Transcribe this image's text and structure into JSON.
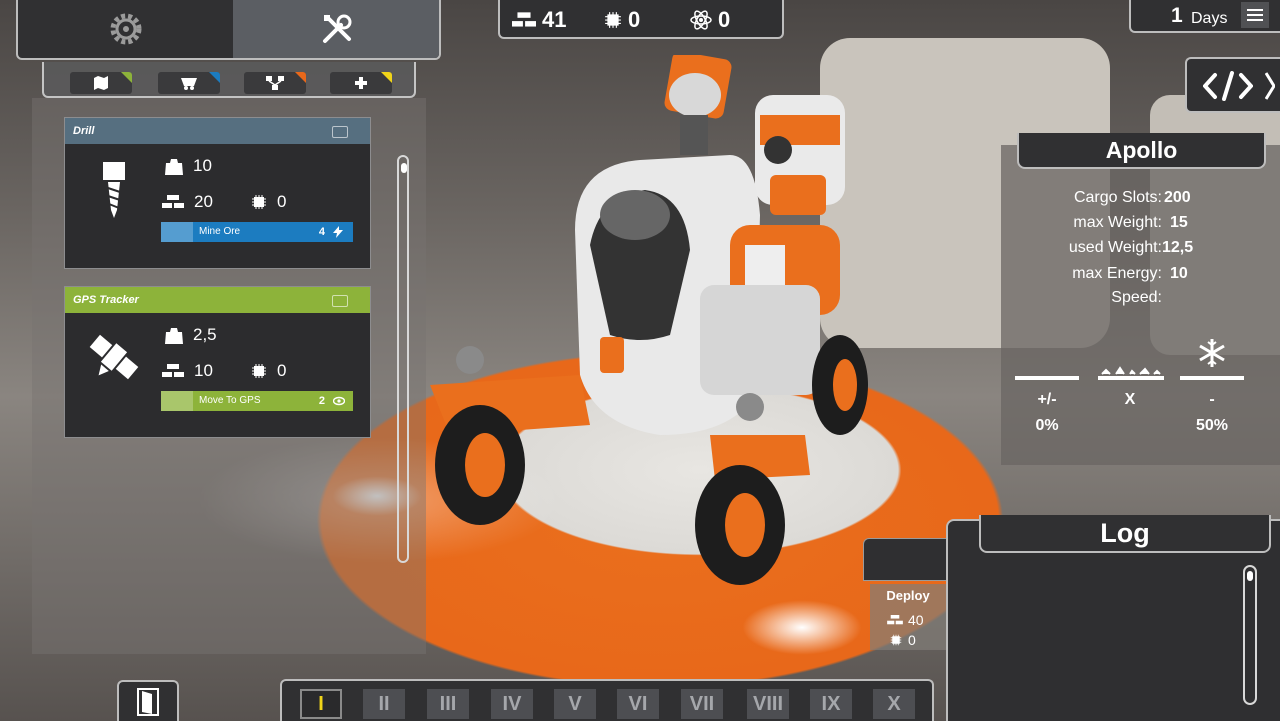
{
  "colors": {
    "panel": "#303032",
    "blue_accent": "#1c7cc0",
    "green_accent": "#8db33a",
    "yellow_active": "#f0d419",
    "orange_scene": "#e8681a"
  },
  "tabs": [
    {
      "icon": "gear-icon"
    },
    {
      "icon": "wrench-screwdriver-icon"
    }
  ],
  "subtabs": [
    {
      "icon": "map-icon",
      "accent": "#8db33a"
    },
    {
      "icon": "mine-cart-icon",
      "accent": "#1c7cc0"
    },
    {
      "icon": "network-icon",
      "accent": "#e8681a"
    },
    {
      "icon": "plus-icon",
      "accent": "#f0d419"
    }
  ],
  "modules": [
    {
      "name": "Drill",
      "icon": "drill-icon",
      "weight": "10",
      "bars": "20",
      "chips": "0",
      "action_label": "Mine Ore",
      "action_cost": "4",
      "action_icon": "mine-cart-icon",
      "cost_icon": "lightning-icon",
      "header_color": "#566f80",
      "action_color": "#1c7cc0"
    },
    {
      "name": "GPS Tracker",
      "icon": "satellite-icon",
      "weight": "2,5",
      "bars": "10",
      "chips": "0",
      "action_label": "Move To GPS",
      "action_cost": "2",
      "action_icon": "map-icon",
      "cost_icon": "eye-icon",
      "header_color": "#8db33a",
      "action_color": "#8db33a"
    }
  ],
  "resources": {
    "bars": "41",
    "chips": "0",
    "atoms": "0"
  },
  "days": {
    "count": "1",
    "label": "Days"
  },
  "robot": {
    "name": "Apollo",
    "stats": [
      {
        "label": "Cargo Slots:",
        "value": "200"
      },
      {
        "label": "max Weight:",
        "value": "15"
      },
      {
        "label": "used Weight:",
        "value": "12,5"
      },
      {
        "label": "max Energy:",
        "value": "10"
      },
      {
        "label": "Speed:",
        "value": ""
      }
    ],
    "modifiers": [
      {
        "icon": "flat-terrain-icon",
        "label": "+/-",
        "value": "0%"
      },
      {
        "icon": "rocky-terrain-icon",
        "label": "X",
        "value": ""
      },
      {
        "icon": "snowflake-icon",
        "label": "-",
        "value": "50%"
      }
    ]
  },
  "log": {
    "title": "Log"
  },
  "deploy": {
    "label": "Deploy",
    "bars": "40",
    "chips": "0"
  },
  "slots": [
    "I",
    "II",
    "III",
    "IV",
    "V",
    "VI",
    "VII",
    "VIII",
    "IX",
    "X"
  ],
  "active_slot": "I"
}
